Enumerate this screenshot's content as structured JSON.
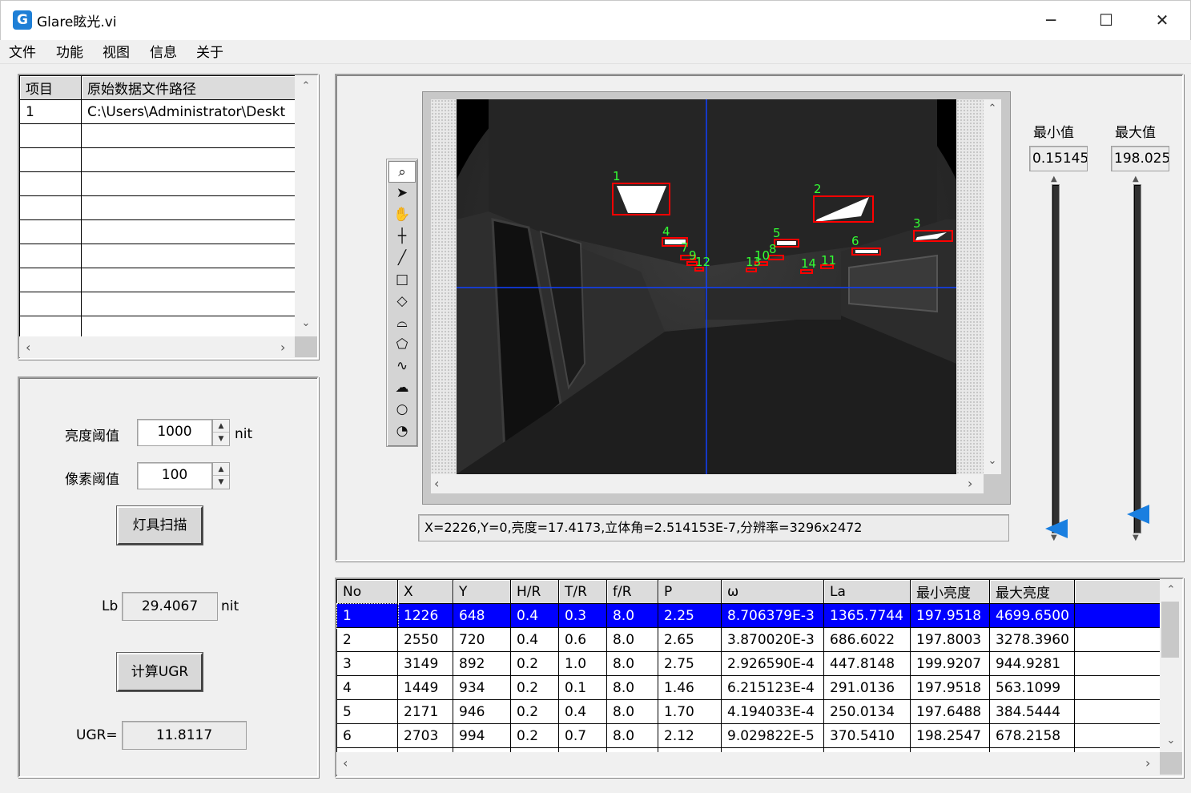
{
  "window": {
    "icon_letter": "G",
    "title": "Glare眩光.vi",
    "min_label": "─",
    "max_label": "☐",
    "close_label": "✕"
  },
  "menu": [
    "文件",
    "功能",
    "视图",
    "信息",
    "关于"
  ],
  "file_table": {
    "headers": [
      "项目",
      "原始数据文件路径"
    ],
    "rows": [
      [
        "1",
        "C:\\Users\\Administrator\\Deskt"
      ]
    ]
  },
  "controls": {
    "brightness_label": "亮度阈值",
    "brightness_value": "1000",
    "brightness_unit": "nit",
    "pixel_label": "像素阈值",
    "pixel_value": "100",
    "scan_button": "灯具扫描",
    "lb_label": "Lb",
    "lb_value": "29.4067",
    "lb_unit": "nit",
    "ugr_button": "计算UGR",
    "ugr_label": "UGR=",
    "ugr_value": "11.8117"
  },
  "range": {
    "min_label": "最小值",
    "min_value": "0.15145",
    "max_label": "最大值",
    "max_value": "198.025"
  },
  "status_text": "X=2226,Y=0,亮度=17.4173,立体角=2.514153E-7,分辨率=3296x2472",
  "image_labels": [
    "1",
    "2",
    "3",
    "4",
    "5",
    "6",
    "7",
    "8",
    "9",
    "10",
    "11",
    "12",
    "13",
    "14"
  ],
  "tools": [
    "zoom-icon",
    "pointer-icon",
    "pan-icon",
    "crosshair-icon",
    "line-icon",
    "rectangle-icon",
    "rotated-rect-icon",
    "annulus-icon",
    "polygon-icon",
    "freehand-icon",
    "freehand-region-icon",
    "oval-icon",
    "broken-annulus-icon"
  ],
  "results": {
    "headers": [
      "No",
      "X",
      "Y",
      "H/R",
      "T/R",
      "f/R",
      "P",
      "ω",
      "La",
      "最小亮度",
      "最大亮度",
      ""
    ],
    "rows": [
      [
        "1",
        "1226",
        "648",
        "0.4",
        "0.3",
        "8.0",
        "2.25",
        "8.706379E-3",
        "1365.7744",
        "197.9518",
        "4699.6500",
        ""
      ],
      [
        "2",
        "2550",
        "720",
        "0.4",
        "0.6",
        "8.0",
        "2.65",
        "3.870020E-3",
        "686.6022",
        "197.8003",
        "3278.3960",
        ""
      ],
      [
        "3",
        "3149",
        "892",
        "0.2",
        "1.0",
        "8.0",
        "2.75",
        "2.926590E-4",
        "447.8148",
        "199.9207",
        "944.9281",
        ""
      ],
      [
        "4",
        "1449",
        "934",
        "0.2",
        "0.1",
        "8.0",
        "1.46",
        "6.215123E-4",
        "291.0136",
        "197.9518",
        "563.1099",
        ""
      ],
      [
        "5",
        "2171",
        "946",
        "0.2",
        "0.4",
        "8.0",
        "1.70",
        "4.194033E-4",
        "250.0134",
        "197.6488",
        "384.5444",
        ""
      ],
      [
        "6",
        "2703",
        "994",
        "0.2",
        "0.7",
        "8.0",
        "2.12",
        "9.029822E-5",
        "370.5410",
        "198.2547",
        "678.2158",
        ""
      ]
    ]
  }
}
